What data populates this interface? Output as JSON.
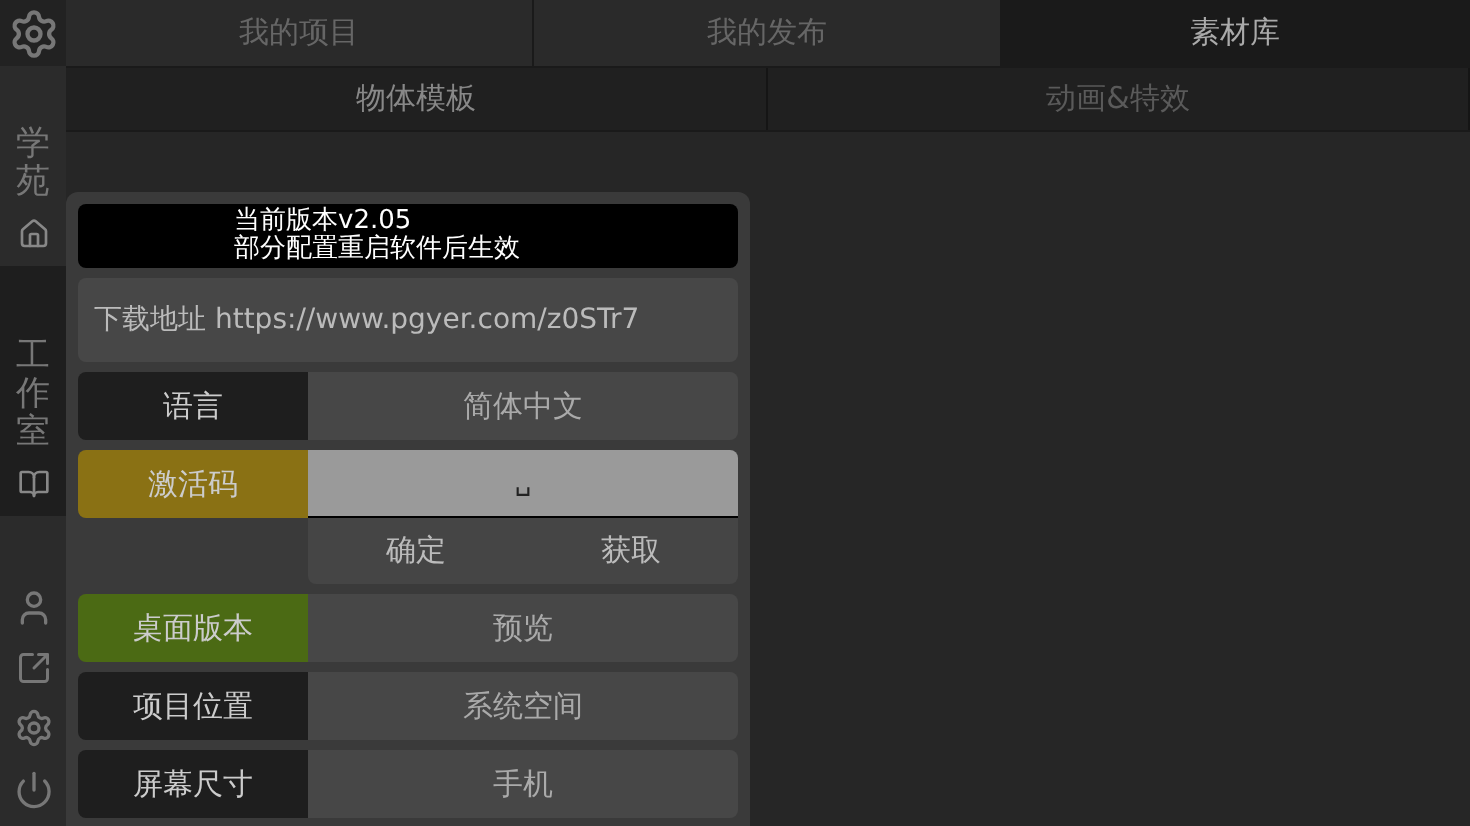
{
  "tabs": [
    {
      "label": "我的项目",
      "selected": false
    },
    {
      "label": "我的发布",
      "selected": false
    },
    {
      "label": "素材库",
      "selected": true
    }
  ],
  "subtabs": [
    {
      "label": "物体模板",
      "selected": true
    },
    {
      "label": "动画&特效",
      "selected": false
    }
  ],
  "sidebar": {
    "sections": [
      {
        "label": "学苑",
        "selected": false
      },
      {
        "label": "工作室",
        "selected": true
      }
    ]
  },
  "dialog": {
    "header": [
      "当前版本v2.05",
      "部分配置重启软件后生效"
    ],
    "download": {
      "label": "下载地址",
      "url": "https://www.pgyer.com/z0STr7"
    },
    "rows": [
      {
        "kind": "value",
        "label": "语言",
        "value": "简体中文",
        "color": "#1e1e1e"
      },
      {
        "kind": "input",
        "label": "激活码",
        "value": "␣",
        "color": "#8a7114"
      },
      {
        "kind": "actions",
        "buttons": [
          "确定",
          "获取"
        ]
      },
      {
        "kind": "value",
        "label": "桌面版本",
        "value": "预览",
        "color": "#4b6a14"
      },
      {
        "kind": "value",
        "label": "项目位置",
        "value": "系统空间",
        "color": "#1e1e1e"
      },
      {
        "kind": "value",
        "label": "屏幕尺寸",
        "value": "手机",
        "color": "#1e1e1e"
      }
    ]
  }
}
